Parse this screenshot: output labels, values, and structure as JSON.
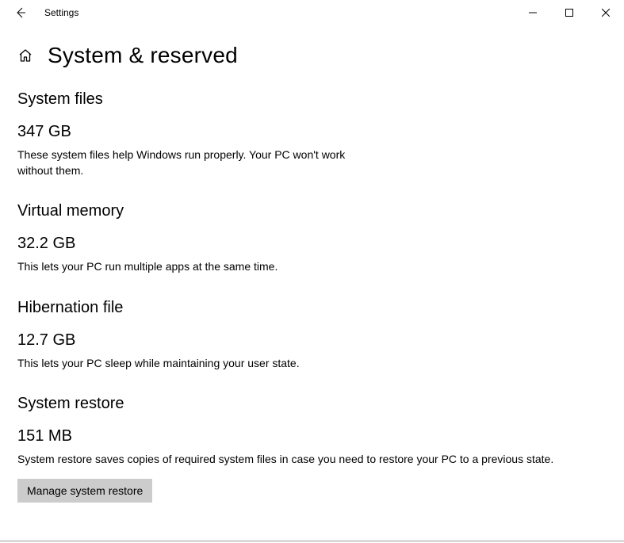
{
  "titlebar": {
    "app_title": "Settings"
  },
  "header": {
    "page_title": "System & reserved"
  },
  "sections": {
    "system_files": {
      "title": "System files",
      "value": "347 GB",
      "desc": "These system files help Windows run properly. Your PC won't work without them."
    },
    "virtual_memory": {
      "title": "Virtual memory",
      "value": "32.2 GB",
      "desc": "This lets your PC run multiple apps at the same time."
    },
    "hibernation": {
      "title": "Hibernation file",
      "value": "12.7 GB",
      "desc": "This lets your PC sleep while maintaining your user state."
    },
    "system_restore": {
      "title": "System restore",
      "value": "151 MB",
      "desc": "System restore saves copies of required system files in case you need to restore your PC to a previous state.",
      "button": "Manage system restore"
    }
  }
}
